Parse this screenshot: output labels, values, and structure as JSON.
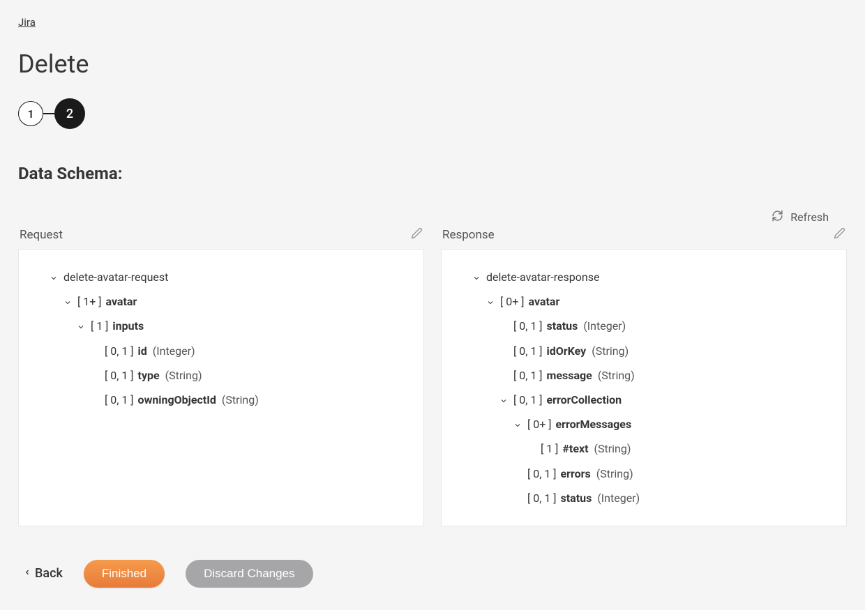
{
  "breadcrumb": "Jira",
  "page_title": "Delete",
  "stepper": {
    "step1": "1",
    "step2": "2"
  },
  "section_title": "Data Schema:",
  "refresh_label": "Refresh",
  "columns": {
    "request": {
      "title": "Request"
    },
    "response": {
      "title": "Response"
    }
  },
  "request_tree": {
    "root": "delete-avatar-request",
    "avatar_card": "[ 1+ ]",
    "avatar_name": "avatar",
    "inputs_card": "[ 1 ]",
    "inputs_name": "inputs",
    "id_card": "[ 0, 1 ]",
    "id_name": "id",
    "id_type": "(Integer)",
    "type_card": "[ 0, 1 ]",
    "type_name": "type",
    "type_type": "(String)",
    "owning_card": "[ 0, 1 ]",
    "owning_name": "owningObjectId",
    "owning_type": "(String)"
  },
  "response_tree": {
    "root": "delete-avatar-response",
    "avatar_card": "[ 0+ ]",
    "avatar_name": "avatar",
    "status_card": "[ 0, 1 ]",
    "status_name": "status",
    "status_type": "(Integer)",
    "idk_card": "[ 0, 1 ]",
    "idk_name": "idOrKey",
    "idk_type": "(String)",
    "msg_card": "[ 0, 1 ]",
    "msg_name": "message",
    "msg_type": "(String)",
    "ec_card": "[ 0, 1 ]",
    "ec_name": "errorCollection",
    "em_card": "[ 0+ ]",
    "em_name": "errorMessages",
    "text_card": "[ 1 ]",
    "text_name": "#text",
    "text_type": "(String)",
    "errors_card": "[ 0, 1 ]",
    "errors_name": "errors",
    "errors_type": "(String)",
    "status2_card": "[ 0, 1 ]",
    "status2_name": "status",
    "status2_type": "(Integer)"
  },
  "footer": {
    "back": "Back",
    "finished": "Finished",
    "discard": "Discard Changes"
  }
}
